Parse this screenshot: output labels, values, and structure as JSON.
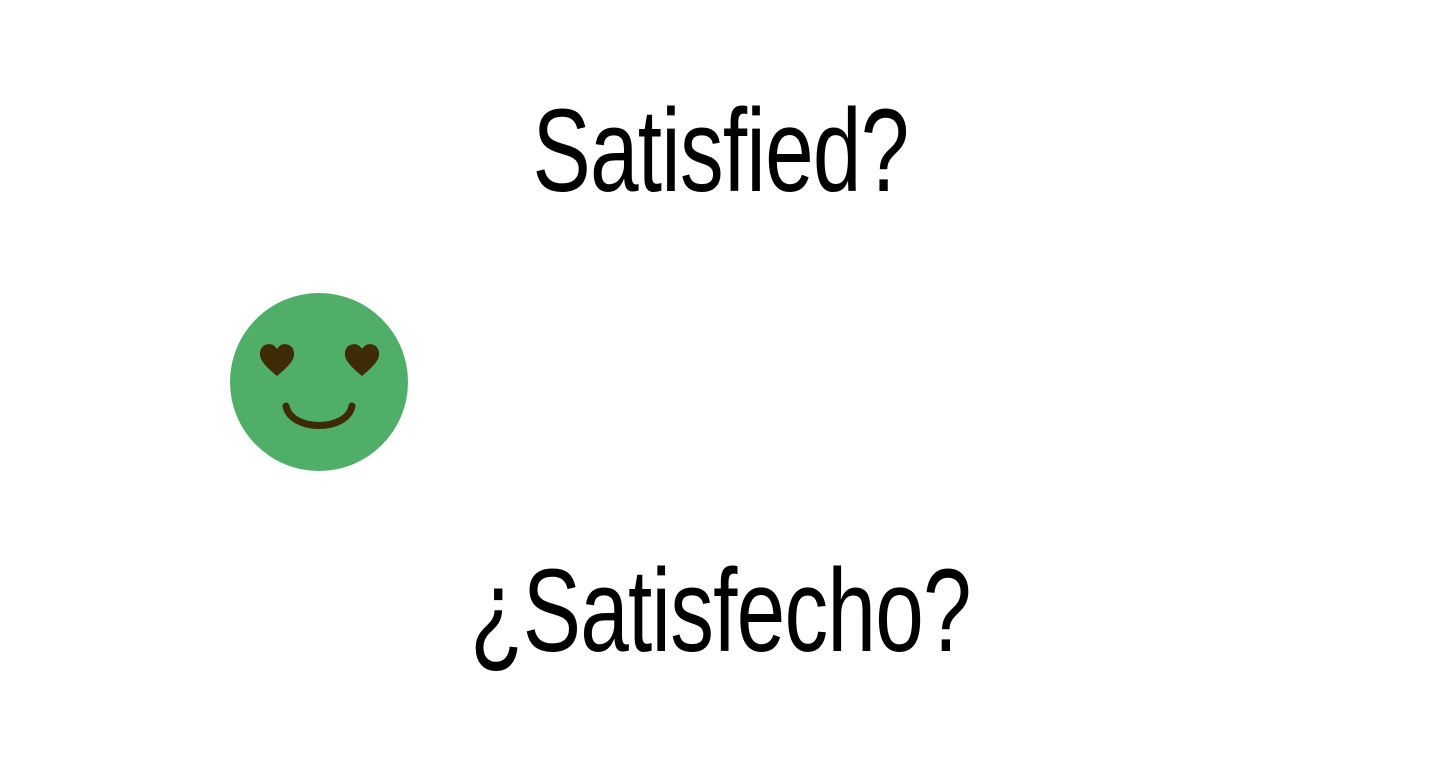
{
  "heading_english": "Satisfied?",
  "heading_spanish": "¿Satisfecho?",
  "face": {
    "icon": "heart-eyes-smiley-icon",
    "face_color": "#4FAF68",
    "feature_color": "#3E2A04"
  }
}
